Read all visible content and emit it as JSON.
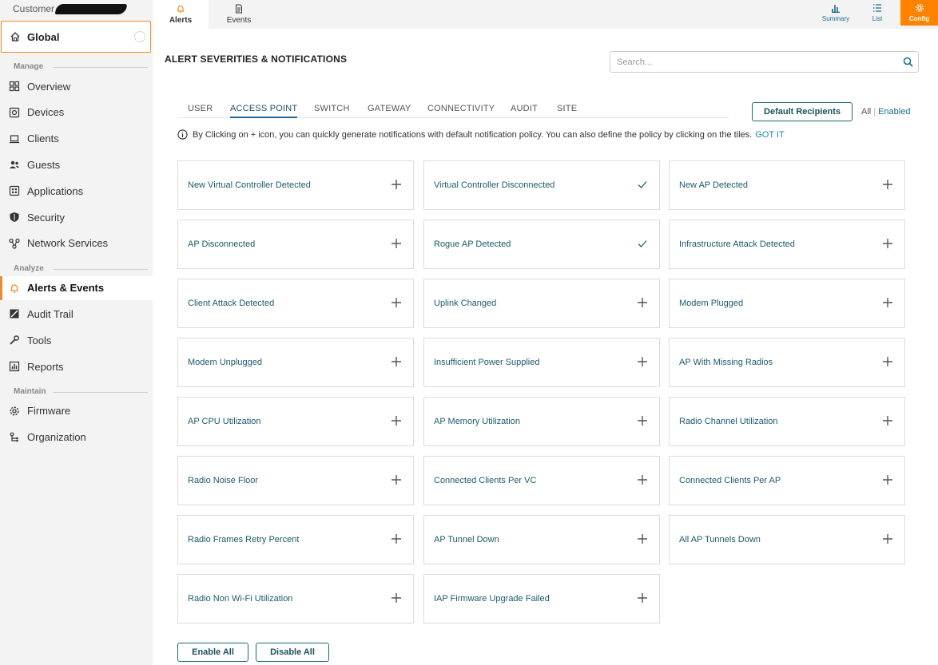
{
  "sidebar": {
    "customer_label": "Customer",
    "scope": "Global",
    "sections": [
      {
        "heading": "Manage",
        "items": [
          {
            "label": "Overview",
            "icon": "grid-icon"
          },
          {
            "label": "Devices",
            "icon": "device-icon"
          },
          {
            "label": "Clients",
            "icon": "laptop-icon"
          },
          {
            "label": "Guests",
            "icon": "users-icon"
          },
          {
            "label": "Applications",
            "icon": "apps-icon"
          },
          {
            "label": "Security",
            "icon": "shield-icon"
          },
          {
            "label": "Network Services",
            "icon": "network-icon"
          }
        ]
      },
      {
        "heading": "Analyze",
        "items": [
          {
            "label": "Alerts & Events",
            "icon": "bell-icon",
            "active": true
          },
          {
            "label": "Audit Trail",
            "icon": "audit-icon"
          },
          {
            "label": "Tools",
            "icon": "wrench-icon"
          },
          {
            "label": "Reports",
            "icon": "report-icon"
          }
        ]
      },
      {
        "heading": "Maintain",
        "items": [
          {
            "label": "Firmware",
            "icon": "gear-icon"
          },
          {
            "label": "Organization",
            "icon": "org-icon"
          }
        ]
      }
    ]
  },
  "top_tabs": {
    "alerts": "Alerts",
    "events": "Events"
  },
  "header_buttons": {
    "summary": "Summary",
    "list": "List",
    "config": "Config"
  },
  "page": {
    "title": "ALERT SEVERITIES & NOTIFICATIONS",
    "search_placeholder": "Search...",
    "category_tabs": [
      "USER",
      "ACCESS POINT",
      "SWITCH",
      "GATEWAY",
      "CONNECTIVITY",
      "AUDIT",
      "SITE"
    ],
    "active_tab": "ACCESS POINT",
    "default_recipients": "Default Recipients",
    "filter": {
      "all": "All",
      "separator": "|",
      "enabled": "Enabled"
    },
    "info_text": "By Clicking on + icon, you can quickly generate notifications with default notification policy. You can also define the policy by clicking on the tiles.",
    "got_it": "GOT IT"
  },
  "tiles": [
    {
      "label": "New Virtual Controller Detected",
      "enabled": false
    },
    {
      "label": "Virtual Controller Disconnected",
      "enabled": true
    },
    {
      "label": "New AP Detected",
      "enabled": false
    },
    {
      "label": "AP Disconnected",
      "enabled": false
    },
    {
      "label": "Rogue AP Detected",
      "enabled": true
    },
    {
      "label": "Infrastructure Attack Detected",
      "enabled": false
    },
    {
      "label": "Client Attack Detected",
      "enabled": false
    },
    {
      "label": "Uplink Changed",
      "enabled": false
    },
    {
      "label": "Modem Plugged",
      "enabled": false
    },
    {
      "label": "Modem Unplugged",
      "enabled": false
    },
    {
      "label": "Insufficient Power Supplied",
      "enabled": false
    },
    {
      "label": "AP With Missing Radios",
      "enabled": false
    },
    {
      "label": "AP CPU Utilization",
      "enabled": false
    },
    {
      "label": "AP Memory Utilization",
      "enabled": false
    },
    {
      "label": "Radio Channel Utilization",
      "enabled": false
    },
    {
      "label": "Radio Noise Floor",
      "enabled": false
    },
    {
      "label": "Connected Clients Per VC",
      "enabled": false
    },
    {
      "label": "Connected Clients Per AP",
      "enabled": false
    },
    {
      "label": "Radio Frames Retry Percent",
      "enabled": false
    },
    {
      "label": "AP Tunnel Down",
      "enabled": false
    },
    {
      "label": "All AP Tunnels Down",
      "enabled": false
    },
    {
      "label": "Radio Non Wi-Fi Utilization",
      "enabled": false
    },
    {
      "label": "IAP Firmware Upgrade Failed",
      "enabled": false
    }
  ],
  "bottom": {
    "enable_all": "Enable All",
    "disable_all": "Disable All"
  },
  "colors": {
    "accent": "#ff8300",
    "teal": "#1b6b8a"
  }
}
